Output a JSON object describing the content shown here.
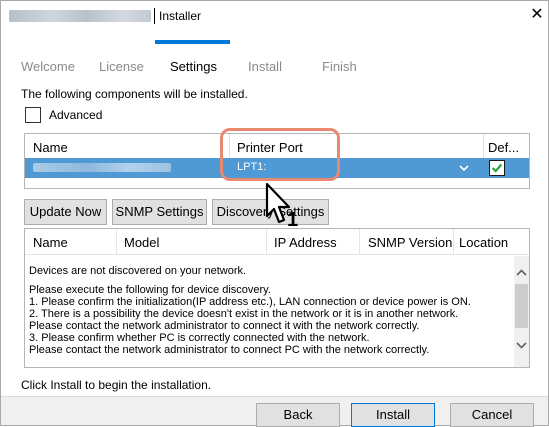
{
  "window": {
    "title": "Installer",
    "close_glyph": "✕"
  },
  "steps": [
    {
      "label": "Welcome",
      "active": false
    },
    {
      "label": "License",
      "active": false
    },
    {
      "label": "Settings",
      "active": true
    },
    {
      "label": "Install",
      "active": false
    },
    {
      "label": "Finish",
      "active": false
    }
  ],
  "components": {
    "description": "The following components will be installed.",
    "advanced_label": "Advanced",
    "advanced_checked": false,
    "columns": [
      "Name",
      "Printer Port",
      "Def..."
    ],
    "row": {
      "printer_port": "LPT1:",
      "default_checked": true
    }
  },
  "buttons": {
    "update_now": "Update Now",
    "snmp_settings": "SNMP Settings",
    "discovery_settings": "Discovery Settings"
  },
  "devices": {
    "columns": [
      "Name",
      "Model",
      "IP Address",
      "SNMP Version",
      "Location"
    ],
    "messages": [
      "Devices are not discovered on your network.",
      "Please execute the following for device discovery.",
      "1. Please confirm the initialization(IP address etc.), LAN connection or device power is ON.",
      "2. There is a possibility the device doesn't exist in the network or it is in another network.",
      "Please contact the network administrator to connect it with the network correctly.",
      "3. Please confirm whether PC is correctly connected with the network.",
      "Please contact the network administrator to connect PC with the network correctly."
    ]
  },
  "footer": {
    "message": "Click Install to begin the installation.",
    "back": "Back",
    "install": "Install",
    "cancel": "Cancel"
  },
  "annotation": {
    "step_number": "1",
    "highlight_color": "#e98a70"
  },
  "colors": {
    "accent": "#0078d7",
    "selected_row": "#4f9ad4",
    "check_green": "#1fa33a"
  },
  "icons": [
    "close-icon",
    "chevron-down-icon",
    "checkbox-checked-icon",
    "scroll-up-icon",
    "scroll-down-icon",
    "mouse-cursor-icon"
  ]
}
